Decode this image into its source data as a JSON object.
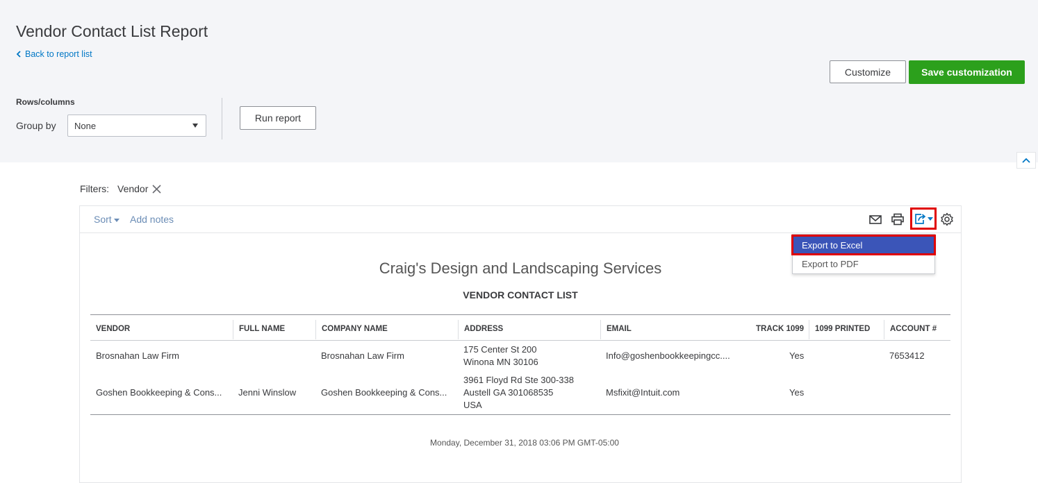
{
  "header": {
    "title": "Vendor Contact List Report",
    "back_link": "Back to report list",
    "customize_label": "Customize",
    "save_label": "Save customization"
  },
  "options": {
    "section_label": "Rows/columns",
    "group_by_label": "Group by",
    "group_by_value": "None",
    "run_label": "Run report"
  },
  "filters": {
    "label": "Filters:",
    "chip": "Vendor"
  },
  "toolbar": {
    "sort_label": "Sort",
    "notes_label": "Add notes",
    "icons": [
      "email-icon",
      "print-icon",
      "export-icon",
      "gear-icon"
    ]
  },
  "export_menu": {
    "excel": "Export to Excel",
    "pdf": "Export to PDF"
  },
  "report": {
    "company": "Craig's Design and Landscaping Services",
    "title": "VENDOR CONTACT LIST",
    "columns": [
      "VENDOR",
      "FULL NAME",
      "COMPANY NAME",
      "ADDRESS",
      "EMAIL",
      "TRACK 1099",
      "1099 PRINTED",
      "ACCOUNT #"
    ],
    "rows": [
      {
        "vendor": "Brosnahan Law Firm",
        "full_name": "",
        "company": "Brosnahan Law Firm",
        "address_1": "175 Center St 200",
        "address_2": "Winona MN 30106",
        "email": "Info@goshenbookkeepingcc....",
        "track": "Yes",
        "printed": "",
        "account": "7653412"
      },
      {
        "vendor": "Goshen Bookkeeping & Cons...",
        "full_name": "Jenni Winslow",
        "company": "Goshen Bookkeeping & Cons...",
        "address_1": "3961 Floyd Rd Ste 300-338",
        "address_2": "Austell GA 301068535",
        "address_3": "USA",
        "email": "Msfixit@Intuit.com",
        "track": "Yes",
        "printed": "",
        "account": ""
      }
    ],
    "footer": "Monday, December 31, 2018   03:06 PM GMT-05:00"
  },
  "colors": {
    "primary_green": "#2ca01c",
    "link_blue": "#0077c5",
    "menu_highlight": "#3b55b8",
    "annotation_red": "#e00000"
  }
}
